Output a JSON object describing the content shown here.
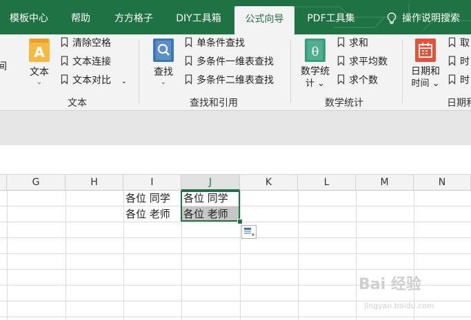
{
  "tabs": [
    {
      "label": "模板中心",
      "active": false
    },
    {
      "label": "帮助",
      "active": false
    },
    {
      "label": "方方格子",
      "active": false
    },
    {
      "label": "DIY工具箱",
      "active": false
    },
    {
      "label": "公式向导",
      "active": true
    },
    {
      "label": "PDF工具集",
      "active": false
    },
    {
      "label": "操作说明搜索",
      "active": false
    }
  ],
  "ribbon": {
    "edge_left_char": "间",
    "groups": {
      "text": {
        "label": "文本",
        "big_button": {
          "label": "文本",
          "chevron": "⌄"
        },
        "items": [
          "清除空格",
          "文本连接",
          "文本对比"
        ],
        "extra_chevron": "⌄"
      },
      "lookup": {
        "label": "查找和引用",
        "big_button": {
          "label": "查找",
          "chevron": "⌄"
        },
        "items": [
          "单条件查找",
          "多条件一维表查找",
          "多条件二维表查找"
        ]
      },
      "math": {
        "label": "数学统计",
        "big_button": {
          "label_line1": "数学统",
          "label_line2": "计 ⌄"
        },
        "items": [
          "求和",
          "求平均数",
          "求个数"
        ]
      },
      "date": {
        "label": "日期和",
        "big_button": {
          "label_line1": "日期和",
          "label_line2": "时间 ⌄"
        },
        "items": [
          "取",
          "时",
          "时"
        ]
      }
    }
  },
  "grid": {
    "columns": [
      "G",
      "H",
      "I",
      "J",
      "K",
      "L",
      "M",
      "N"
    ],
    "selected_column": "J",
    "cells": {
      "I1": "各位 同学",
      "I2": "各位 老师",
      "J1": "各位 同学",
      "J2": "各位 老师"
    }
  },
  "watermark": {
    "text": "Bai 经验",
    "sub": "jingyan.baidu.com"
  },
  "colors": {
    "accent": "#1f7244",
    "ribbon_bg": "#f3f3f3"
  }
}
